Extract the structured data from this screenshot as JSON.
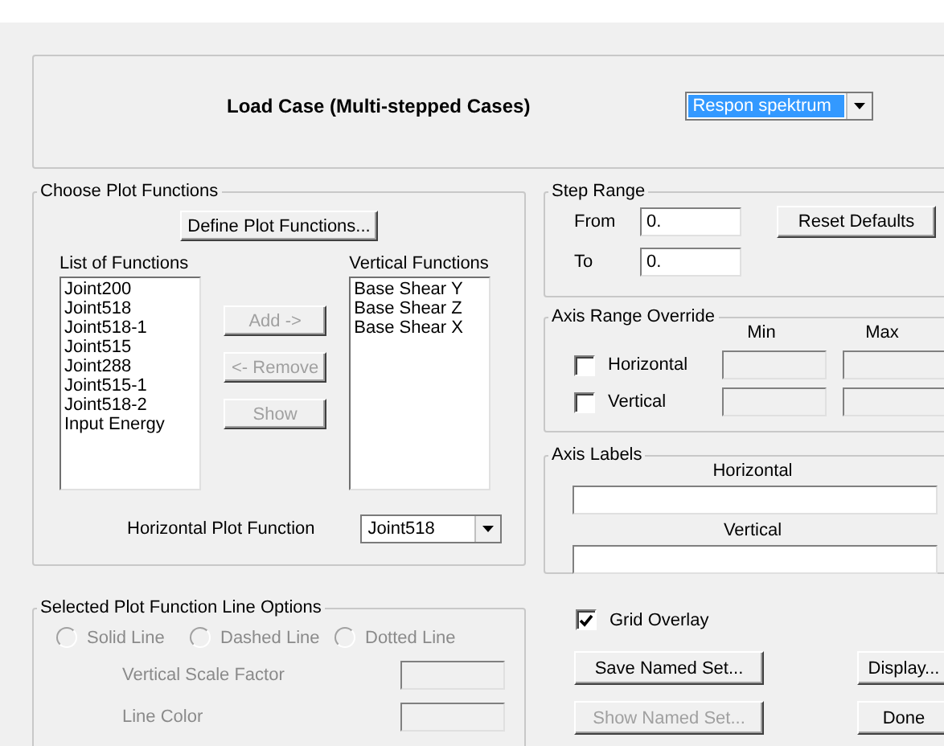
{
  "load_case": {
    "label": "Load Case (Multi-stepped Cases)",
    "value": "Respon spektrum"
  },
  "plot_functions": {
    "title": "Choose Plot Functions",
    "define_button": "Define Plot Functions...",
    "list_label": "List of Functions",
    "list": [
      "Joint200",
      "Joint518",
      "Joint518-1",
      "Joint515",
      "Joint288",
      "Joint515-1",
      "Joint518-2",
      "Input Energy"
    ],
    "buttons": [
      {
        "label": "Add ->",
        "disabled": true
      },
      {
        "label": "<- Remove",
        "disabled": true
      },
      {
        "label": "Show",
        "disabled": true
      }
    ],
    "vertical_label": "Vertical Functions",
    "vertical_list": [
      "Base Shear Y",
      "Base Shear Z",
      "Base Shear X"
    ],
    "horizontal_label": "Horizontal Plot Function",
    "horizontal_value": "Joint518"
  },
  "step_range": {
    "title": "Step Range",
    "from_label": "From",
    "from_value": "0.",
    "to_label": "To",
    "to_value": "0.",
    "reset_button": "Reset Defaults"
  },
  "axis_range": {
    "title": "Axis Range Override",
    "min_label": "Min",
    "max_label": "Max",
    "rows": [
      {
        "label": "Horizontal",
        "checked": false
      },
      {
        "label": "Vertical",
        "checked": false
      }
    ]
  },
  "axis_labels": {
    "title": "Axis Labels",
    "horizontal_label": "Horizontal",
    "vertical_label": "Vertical"
  },
  "line_options": {
    "title": "Selected Plot Function Line Options",
    "disabled": true,
    "styles": [
      {
        "label": "Solid Line",
        "selected": false
      },
      {
        "label": "Dashed Line",
        "selected": false
      },
      {
        "label": "Dotted Line",
        "selected": false
      }
    ],
    "fields": [
      "Vertical  Scale Factor",
      "Line Color"
    ]
  },
  "grid_overlay": {
    "label": "Grid Overlay",
    "checked": true
  },
  "buttons": [
    {
      "label": "Save Named Set...",
      "disabled": false
    },
    {
      "label": "Display...",
      "disabled": false
    },
    {
      "label": "Show Named Set...",
      "disabled": true
    },
    {
      "label": "Done",
      "disabled": false
    }
  ]
}
